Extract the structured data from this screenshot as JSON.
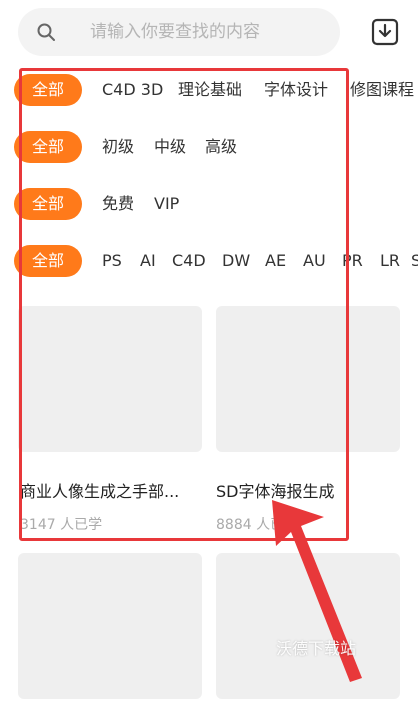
{
  "search": {
    "placeholder": "请输入你要查找的内容"
  },
  "filters": {
    "row1": {
      "all_label": "全部",
      "options": [
        "C4D 3D",
        "理论基础",
        "字体设计",
        "修图课程"
      ]
    },
    "row2": {
      "all_label": "全部",
      "options": [
        "初级",
        "中级",
        "高级"
      ]
    },
    "row3": {
      "all_label": "全部",
      "options": [
        "免费",
        "VIP"
      ]
    },
    "row4": {
      "all_label": "全部",
      "options": [
        "PS",
        "AI",
        "C4D",
        "DW",
        "AE",
        "AU",
        "PR",
        "LR",
        "S"
      ]
    }
  },
  "courses": [
    {
      "title": "商业人像生成之手部...",
      "learners": "3147 人已学"
    },
    {
      "title": "SD字体海报生成",
      "learners": "8884 人已学"
    }
  ],
  "watermark": "沃德下载站",
  "colors": {
    "accent": "#ff7a1a",
    "annotation": "#e8383a"
  }
}
